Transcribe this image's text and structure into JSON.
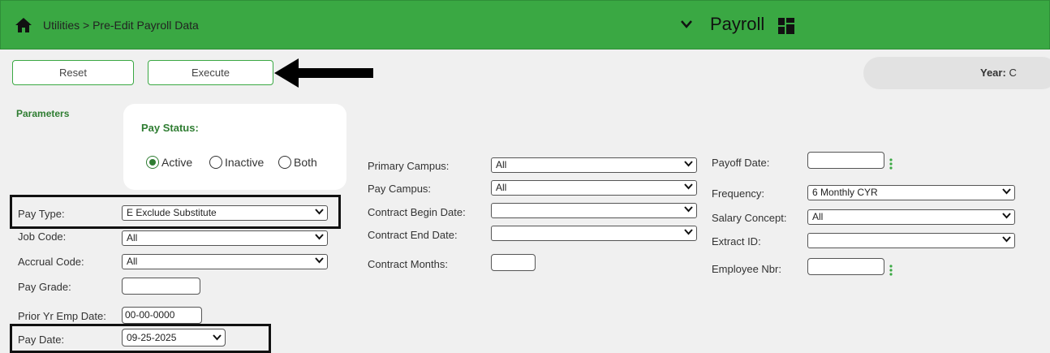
{
  "header": {
    "breadcrumb": "Utilities > Pre-Edit Payroll Data",
    "module_title": "Payroll",
    "bar_color": "#3aa843"
  },
  "toolbar": {
    "reset_label": "Reset",
    "execute_label": "Execute",
    "year_label": "Year:",
    "year_value": "C"
  },
  "parameters": {
    "section_label": "Parameters",
    "pay_status": {
      "title": "Pay Status:",
      "options": [
        "Active",
        "Inactive",
        "Both"
      ],
      "selected": "Active"
    },
    "left": {
      "pay_type_label": "Pay Type:",
      "pay_type_value": "E Exclude Substitute",
      "job_code_label": "Job Code:",
      "job_code_value": "All",
      "accrual_code_label": "Accrual Code:",
      "accrual_code_value": "All",
      "pay_grade_label": "Pay Grade:",
      "pay_grade_value": "",
      "prior_yr_label": "Prior Yr Emp Date:",
      "prior_yr_value": "00-00-0000",
      "pay_date_label": "Pay Date:",
      "pay_date_value": "09-25-2025"
    },
    "middle": {
      "primary_campus_label": "Primary Campus:",
      "primary_campus_value": "All",
      "pay_campus_label": "Pay Campus:",
      "pay_campus_value": "All",
      "contract_begin_label": "Contract Begin Date:",
      "contract_begin_value": "",
      "contract_end_label": "Contract End Date:",
      "contract_end_value": "",
      "contract_months_label": "Contract Months:",
      "contract_months_value": ""
    },
    "right": {
      "payoff_date_label": "Payoff Date:",
      "payoff_date_value": "",
      "frequency_label": "Frequency:",
      "frequency_value": "6 Monthly CYR",
      "salary_concept_label": "Salary Concept:",
      "salary_concept_value": "All",
      "extract_id_label": "Extract ID:",
      "extract_id_value": "",
      "employee_nbr_label": "Employee Nbr:",
      "employee_nbr_value": ""
    }
  }
}
